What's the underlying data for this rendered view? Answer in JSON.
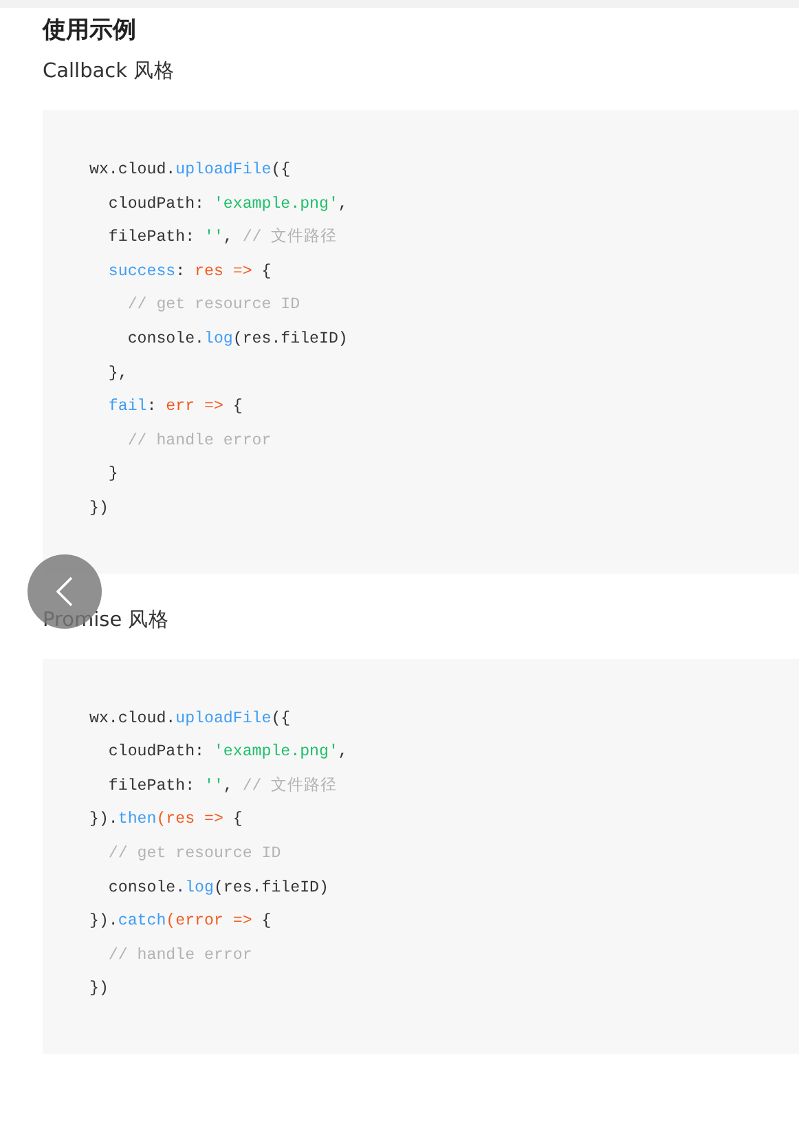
{
  "heading": "使用示例",
  "sections": [
    {
      "label": "Callback 风格",
      "code": [
        [
          {
            "kind": "plain",
            "text": "wx.cloud."
          },
          {
            "kind": "fn",
            "text": "uploadFile"
          },
          {
            "kind": "plain",
            "text": "({"
          }
        ],
        [
          {
            "kind": "plain",
            "text": "  cloudPath: "
          },
          {
            "kind": "str",
            "text": "'example.png'"
          },
          {
            "kind": "plain",
            "text": ","
          }
        ],
        [
          {
            "kind": "plain",
            "text": "  filePath: "
          },
          {
            "kind": "str",
            "text": "''"
          },
          {
            "kind": "plain",
            "text": ", "
          },
          {
            "kind": "com",
            "text": "// 文件路径"
          }
        ],
        [
          {
            "kind": "fn",
            "text": "  success"
          },
          {
            "kind": "plain",
            "text": ": "
          },
          {
            "kind": "arg",
            "text": "res =>"
          },
          {
            "kind": "plain",
            "text": " {"
          }
        ],
        [
          {
            "kind": "com",
            "text": "    // get resource ID"
          }
        ],
        [
          {
            "kind": "plain",
            "text": "    console."
          },
          {
            "kind": "fn",
            "text": "log"
          },
          {
            "kind": "plain",
            "text": "(res.fileID)"
          }
        ],
        [
          {
            "kind": "plain",
            "text": "  },"
          }
        ],
        [
          {
            "kind": "fn",
            "text": "  fail"
          },
          {
            "kind": "plain",
            "text": ": "
          },
          {
            "kind": "arg",
            "text": "err =>"
          },
          {
            "kind": "plain",
            "text": " {"
          }
        ],
        [
          {
            "kind": "com",
            "text": "    // handle error"
          }
        ],
        [
          {
            "kind": "plain",
            "text": "  }"
          }
        ],
        [
          {
            "kind": "plain",
            "text": "})"
          }
        ]
      ]
    },
    {
      "label": "Promise 风格",
      "code": [
        [
          {
            "kind": "plain",
            "text": "wx.cloud."
          },
          {
            "kind": "fn",
            "text": "uploadFile"
          },
          {
            "kind": "plain",
            "text": "({"
          }
        ],
        [
          {
            "kind": "plain",
            "text": "  cloudPath: "
          },
          {
            "kind": "str",
            "text": "'example.png'"
          },
          {
            "kind": "plain",
            "text": ","
          }
        ],
        [
          {
            "kind": "plain",
            "text": "  filePath: "
          },
          {
            "kind": "str",
            "text": "''"
          },
          {
            "kind": "plain",
            "text": ", "
          },
          {
            "kind": "com",
            "text": "// 文件路径"
          }
        ],
        [
          {
            "kind": "plain",
            "text": "})."
          },
          {
            "kind": "fn",
            "text": "then"
          },
          {
            "kind": "arg",
            "text": "(res =>"
          },
          {
            "kind": "plain",
            "text": " {"
          }
        ],
        [
          {
            "kind": "com",
            "text": "  // get resource ID"
          }
        ],
        [
          {
            "kind": "plain",
            "text": "  console."
          },
          {
            "kind": "fn",
            "text": "log"
          },
          {
            "kind": "plain",
            "text": "(res.fileID)"
          }
        ],
        [
          {
            "kind": "plain",
            "text": "})."
          },
          {
            "kind": "fn",
            "text": "catch"
          },
          {
            "kind": "arg",
            "text": "(error =>"
          },
          {
            "kind": "plain",
            "text": " {"
          }
        ],
        [
          {
            "kind": "com",
            "text": "  // handle error"
          }
        ],
        [
          {
            "kind": "plain",
            "text": "})"
          }
        ]
      ]
    }
  ]
}
